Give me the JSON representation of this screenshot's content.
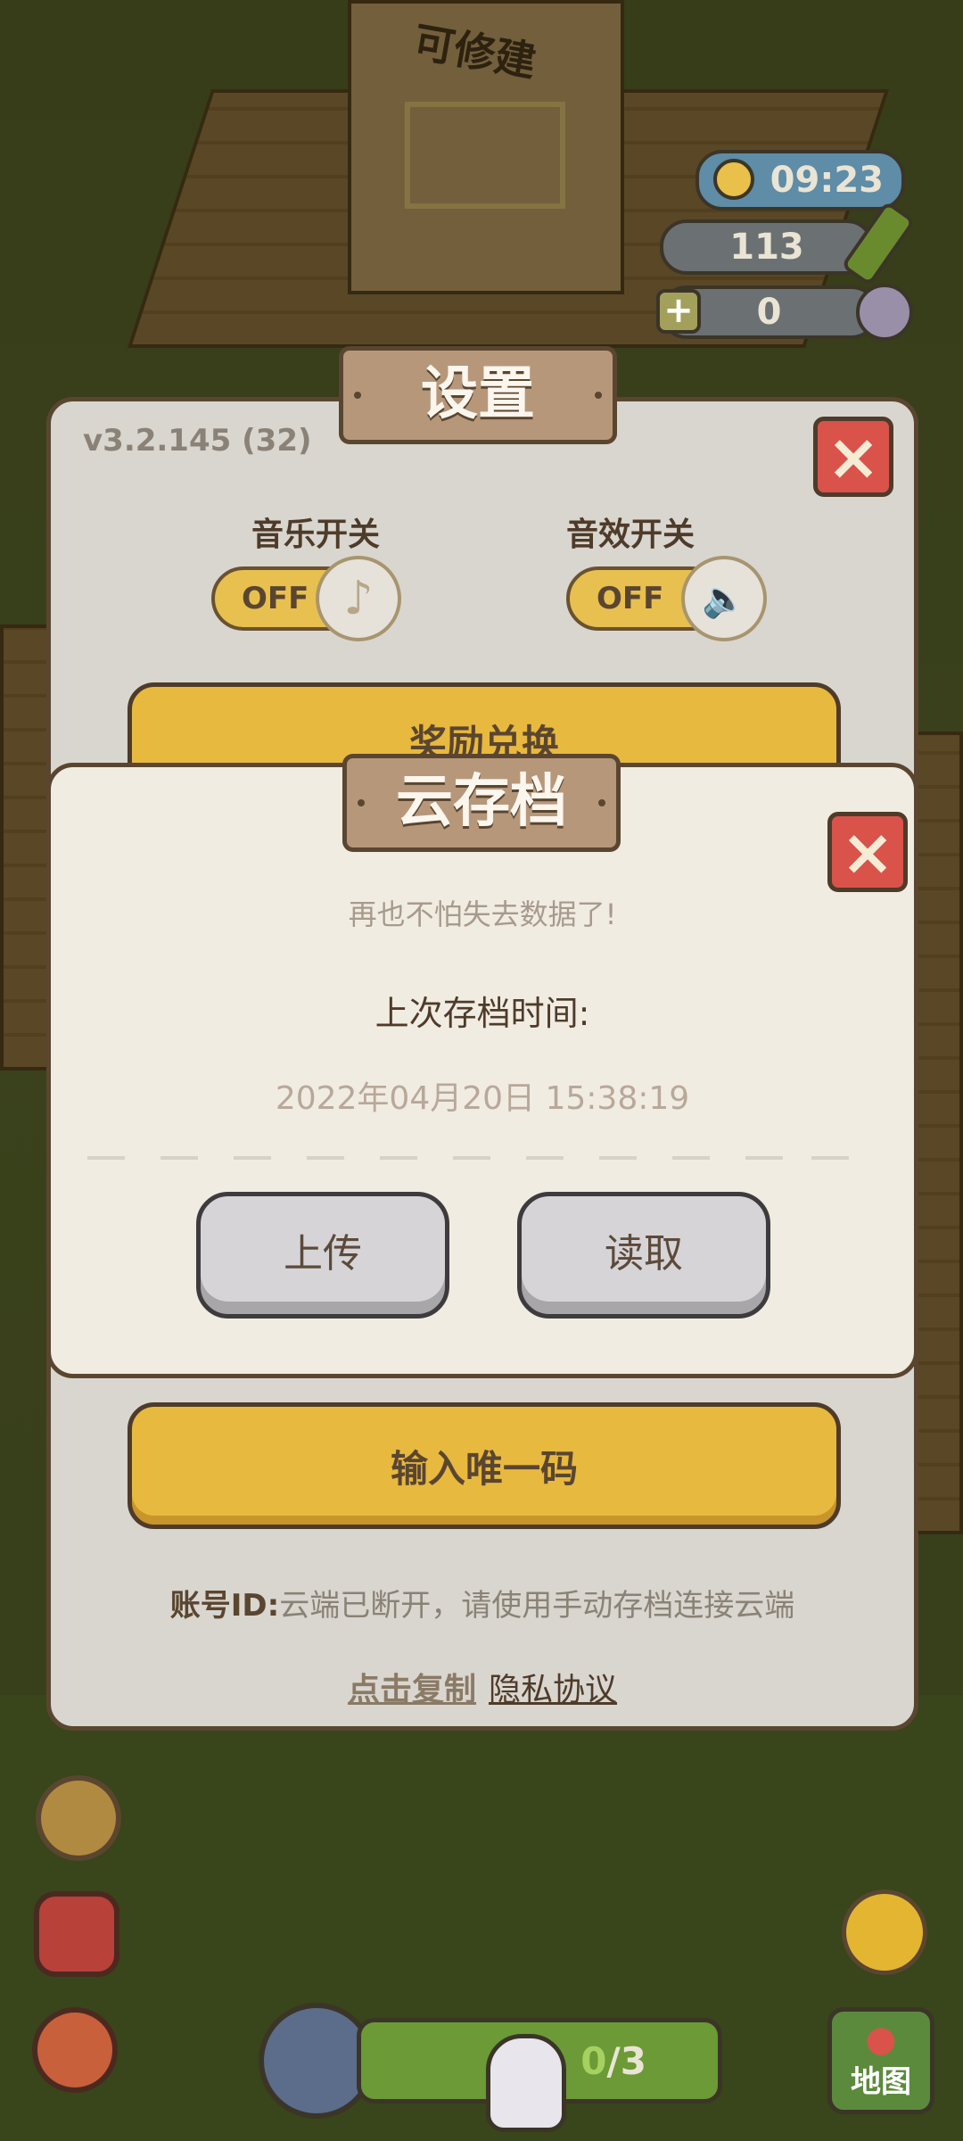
{
  "hud": {
    "time": "09:23",
    "bamboo_count": "113",
    "pearl_count": "0",
    "plus_icon": "plus-icon"
  },
  "scene": {
    "sign_text": "可修建",
    "sign_text_right": "可修建"
  },
  "settings": {
    "title": "设置",
    "version": "v3.2.145 (32)",
    "music_label": "音乐开关",
    "music_state": "OFF",
    "sound_label": "音效开关",
    "sound_state": "OFF",
    "reward_button": "奖励兑换",
    "unique_code_button": "输入唯一码",
    "account_label": "账号ID:",
    "account_status": "云端已断开，请使用手动存档连接云端",
    "copy_link": "点击复制",
    "privacy_link": "隐私协议"
  },
  "cloud_save": {
    "title": "云存档",
    "subtitle": "再也不怕失去数据了!",
    "last_save_label": "上次存档时间:",
    "last_save_time": "2022年04月20日 15:38:19",
    "upload_button": "上传",
    "load_button": "读取"
  },
  "bottom": {
    "progress_current": "0",
    "progress_total": "/3",
    "map_label": "地图"
  },
  "colors": {
    "panel": "#d9d6cf",
    "dialog": "#f1ece2",
    "accent_yellow": "#e8b93f",
    "close_red": "#d9534a",
    "plaque": "#b7977a"
  }
}
